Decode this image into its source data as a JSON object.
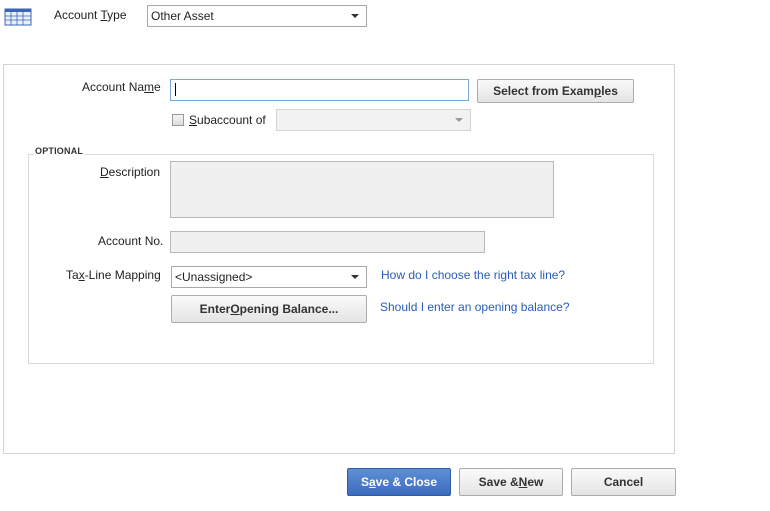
{
  "header": {
    "account_type_label_pre": "Account ",
    "account_type_label_u": "T",
    "account_type_label_post": "ype",
    "account_type_value": "Other Asset"
  },
  "form": {
    "account_name_label_pre": "Account Na",
    "account_name_label_u": "m",
    "account_name_label_post": "e",
    "account_name_value": "",
    "select_examples_pre": "Select from Exam",
    "select_examples_u": "p",
    "select_examples_post": "les",
    "subaccount_checked": false,
    "subaccount_label_u": "S",
    "subaccount_label_post": "ubaccount of",
    "subaccount_value": ""
  },
  "optional": {
    "section_title": "OPTIONAL",
    "description_label_u": "D",
    "description_label_post": "escription",
    "description_value": "",
    "account_no_label": "Account No.",
    "account_no_value": "",
    "taxline_label_pre": "Ta",
    "taxline_label_u": "x",
    "taxline_label_post": "-Line Mapping",
    "taxline_value": "<Unassigned>",
    "taxline_help_link": "How do I choose the right tax line?",
    "opening_balance_pre": "Enter ",
    "opening_balance_u": "O",
    "opening_balance_post": "pening Balance...",
    "opening_balance_help_link": "Should I enter an opening balance?"
  },
  "footer": {
    "save_close_pre": "S",
    "save_close_u": "a",
    "save_close_post": "ve & Close",
    "save_new_pre": "Save & ",
    "save_new_u": "N",
    "save_new_post": "ew",
    "cancel_label": "Cancel"
  },
  "icons": {
    "account_icon": "account-register-icon"
  },
  "colors": {
    "primary_button": "#4a7bd0",
    "link": "#2a5cb8"
  }
}
